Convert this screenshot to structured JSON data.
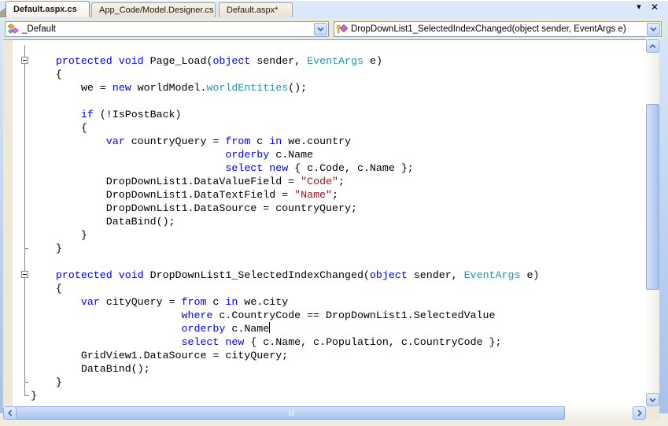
{
  "window": {
    "menu_button": "▾",
    "close_button": "✕"
  },
  "tabs": [
    {
      "label": "Default.aspx.cs",
      "active": true
    },
    {
      "label": "App_Code/Model.Designer.cs",
      "active": false
    },
    {
      "label": "Default.aspx*",
      "active": false
    }
  ],
  "navbar": {
    "types_dropdown": {
      "value": "_Default",
      "icon": "class-icon"
    },
    "members_dropdown": {
      "value": "DropDownList1_SelectedIndexChanged(object sender, EventArgs e)",
      "icon": "method-icon"
    }
  },
  "syntax_colors": {
    "keyword": "#0000ff",
    "type": "#2b91af",
    "string": "#a31515",
    "plain": "#000000"
  },
  "code": {
    "lines": [
      {
        "segments": [
          [
            "    ",
            "pl"
          ],
          [
            "protected",
            "kw"
          ],
          [
            " ",
            "pl"
          ],
          [
            "void",
            "kw"
          ],
          [
            " Page_Load(",
            "pl"
          ],
          [
            "object",
            "kw"
          ],
          [
            " sender, ",
            "pl"
          ],
          [
            "EventArgs",
            "ty"
          ],
          [
            " e)",
            "pl"
          ]
        ]
      },
      {
        "segments": [
          [
            "    {",
            "pl"
          ]
        ]
      },
      {
        "segments": [
          [
            "        we = ",
            "pl"
          ],
          [
            "new",
            "kw"
          ],
          [
            " worldModel.",
            "pl"
          ],
          [
            "worldEntities",
            "ty"
          ],
          [
            "();",
            "pl"
          ]
        ]
      },
      {
        "segments": []
      },
      {
        "segments": [
          [
            "        ",
            "pl"
          ],
          [
            "if",
            "kw"
          ],
          [
            " (!IsPostBack)",
            "pl"
          ]
        ]
      },
      {
        "segments": [
          [
            "        {",
            "pl"
          ]
        ]
      },
      {
        "segments": [
          [
            "            ",
            "pl"
          ],
          [
            "var",
            "kw"
          ],
          [
            " countryQuery = ",
            "pl"
          ],
          [
            "from",
            "kw"
          ],
          [
            " c ",
            "pl"
          ],
          [
            "in",
            "kw"
          ],
          [
            " we.country",
            "pl"
          ]
        ]
      },
      {
        "segments": [
          [
            "                               ",
            "pl"
          ],
          [
            "orderby",
            "kw"
          ],
          [
            " c.Name",
            "pl"
          ]
        ]
      },
      {
        "segments": [
          [
            "                               ",
            "pl"
          ],
          [
            "select",
            "kw"
          ],
          [
            " ",
            "pl"
          ],
          [
            "new",
            "kw"
          ],
          [
            " { c.Code, c.Name };",
            "pl"
          ]
        ]
      },
      {
        "segments": [
          [
            "            DropDownList1.DataValueField = ",
            "pl"
          ],
          [
            "\"Code\"",
            "st"
          ],
          [
            ";",
            "pl"
          ]
        ]
      },
      {
        "segments": [
          [
            "            DropDownList1.DataTextField = ",
            "pl"
          ],
          [
            "\"Name\"",
            "st"
          ],
          [
            ";",
            "pl"
          ]
        ]
      },
      {
        "segments": [
          [
            "            DropDownList1.DataSource = countryQuery;",
            "pl"
          ]
        ]
      },
      {
        "segments": [
          [
            "            DataBind();",
            "pl"
          ]
        ]
      },
      {
        "segments": [
          [
            "        }",
            "pl"
          ]
        ]
      },
      {
        "segments": [
          [
            "    }",
            "pl"
          ]
        ]
      },
      {
        "segments": []
      },
      {
        "segments": [
          [
            "    ",
            "pl"
          ],
          [
            "protected",
            "kw"
          ],
          [
            " ",
            "pl"
          ],
          [
            "void",
            "kw"
          ],
          [
            " DropDownList1_SelectedIndexChanged(",
            "pl"
          ],
          [
            "object",
            "kw"
          ],
          [
            " sender, ",
            "pl"
          ],
          [
            "EventArgs",
            "ty"
          ],
          [
            " e)",
            "pl"
          ]
        ]
      },
      {
        "segments": [
          [
            "    {",
            "pl"
          ]
        ]
      },
      {
        "segments": [
          [
            "        ",
            "pl"
          ],
          [
            "var",
            "kw"
          ],
          [
            " cityQuery = ",
            "pl"
          ],
          [
            "from",
            "kw"
          ],
          [
            " c ",
            "pl"
          ],
          [
            "in",
            "kw"
          ],
          [
            " we.city",
            "pl"
          ]
        ]
      },
      {
        "segments": [
          [
            "                        ",
            "pl"
          ],
          [
            "where",
            "kw"
          ],
          [
            " c.CountryCode == DropDownList1.SelectedValue",
            "pl"
          ]
        ]
      },
      {
        "segments": [
          [
            "                        ",
            "pl"
          ],
          [
            "orderby",
            "kw"
          ],
          [
            " c.Name",
            "pl"
          ]
        ],
        "caret": true
      },
      {
        "segments": [
          [
            "                        ",
            "pl"
          ],
          [
            "select",
            "kw"
          ],
          [
            " ",
            "pl"
          ],
          [
            "new",
            "kw"
          ],
          [
            " { c.Name, c.Population, c.CountryCode };",
            "pl"
          ]
        ]
      },
      {
        "segments": [
          [
            "        GridView1.DataSource = cityQuery;",
            "pl"
          ]
        ]
      },
      {
        "segments": [
          [
            "        DataBind();",
            "pl"
          ]
        ]
      },
      {
        "segments": [
          [
            "    }",
            "pl"
          ]
        ]
      },
      {
        "segments": [
          [
            "}",
            "pl"
          ]
        ]
      }
    ],
    "outline": {
      "fold_boxes": [
        1,
        17
      ],
      "method_end_ticks": [
        15,
        25
      ],
      "class_end_line": 26
    }
  }
}
